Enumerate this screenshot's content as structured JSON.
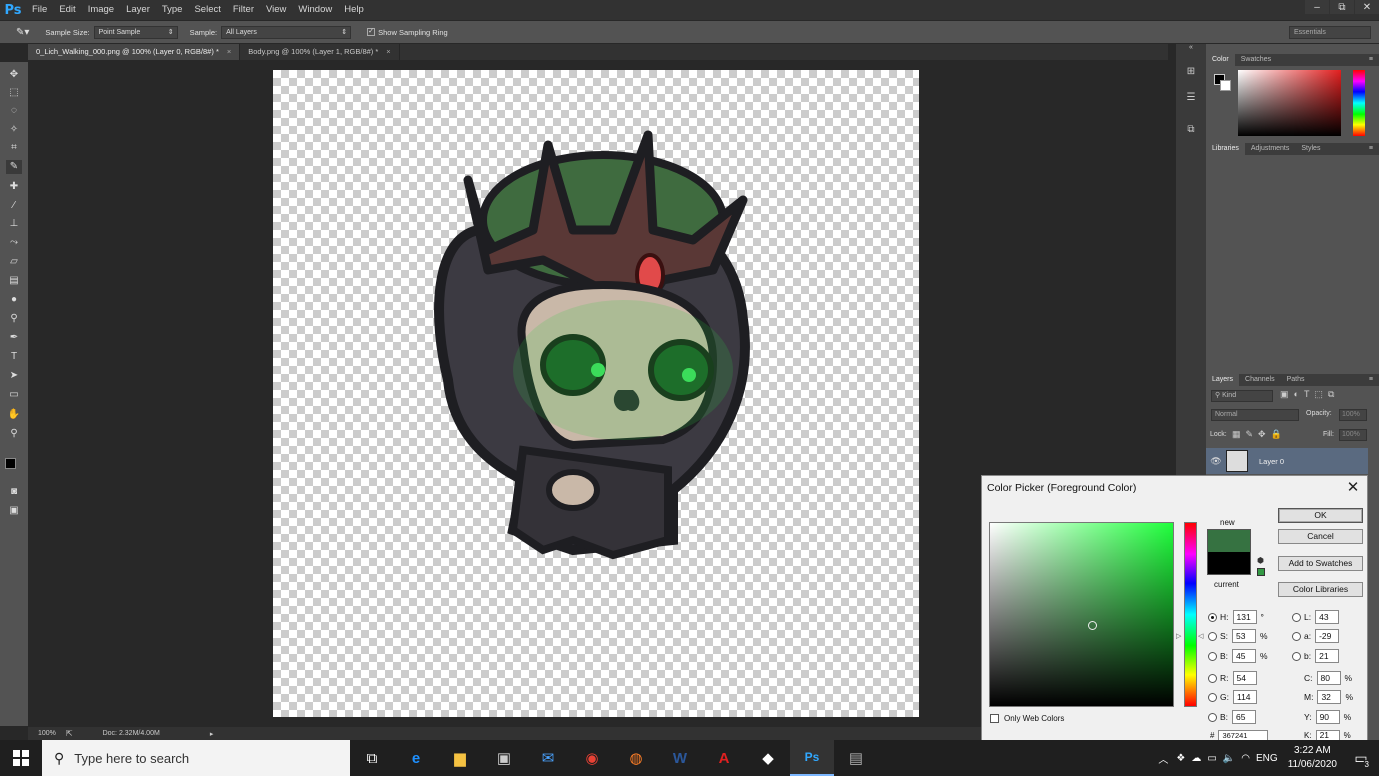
{
  "app": {
    "logo": "Ps"
  },
  "menu": [
    "File",
    "Edit",
    "Image",
    "Layer",
    "Type",
    "Select",
    "Filter",
    "View",
    "Window",
    "Help"
  ],
  "window_controls": [
    "–",
    "⧉",
    "✕"
  ],
  "options_bar": {
    "sample_size_label": "Sample Size:",
    "sample_size_value": "Point Sample",
    "sample_label": "Sample:",
    "sample_value": "All Layers",
    "sampling_ring_label": "Show Sampling Ring",
    "workspace": "Essentials"
  },
  "tabs": [
    {
      "label": "0_Lich_Walking_000.png @ 100% (Layer 0, RGB/8#) *",
      "active": true
    },
    {
      "label": "Body.png @ 100% (Layer 1, RGB/8#) *",
      "active": false
    }
  ],
  "status": {
    "zoom": "100%",
    "doc": "Doc: 2.32M/4.00M"
  },
  "panels": {
    "color_tabs": [
      "Color",
      "Swatches"
    ],
    "library_tabs": [
      "Libraries",
      "Adjustments",
      "Styles"
    ],
    "layers_tabs": [
      "Layers",
      "Channels",
      "Paths"
    ],
    "kind_label": "Kind",
    "blend_mode": "Normal",
    "opacity_label": "Opacity:",
    "opacity_value": "100%",
    "lock_label": "Lock:",
    "fill_label": "Fill:",
    "fill_value": "100%",
    "layer_name": "Layer 0"
  },
  "color_picker": {
    "title": "Color Picker (Foreground Color)",
    "new_label": "new",
    "current_label": "current",
    "new_color": "#367241",
    "current_color": "#000000",
    "buttons": {
      "ok": "OK",
      "cancel": "Cancel",
      "add_swatches": "Add to Swatches",
      "libraries": "Color Libraries"
    },
    "only_web_colors": "Only Web Colors",
    "hsb": {
      "h": "131",
      "s": "53",
      "b": "45"
    },
    "rgb": {
      "r": "54",
      "g": "114",
      "b": "65"
    },
    "lab": {
      "l": "43",
      "a": "-29",
      "b": "21"
    },
    "cmyk": {
      "c": "80",
      "m": "32",
      "y": "90",
      "k": "21"
    },
    "hex": "367241",
    "units": {
      "degree": "°",
      "percent": "%"
    },
    "labels": {
      "H": "H:",
      "S": "S:",
      "B": "B:",
      "R": "R:",
      "G": "G:",
      "B2": "B:",
      "L": "L:",
      "a": "a:",
      "b": "b:",
      "C": "C:",
      "M": "M:",
      "Y": "Y:",
      "K": "K:",
      "hash": "#"
    }
  },
  "taskbar": {
    "search_placeholder": "Type here to search",
    "time": "3:22 AM",
    "date": "11/06/2020",
    "language": "ENG",
    "notifications": "3"
  }
}
